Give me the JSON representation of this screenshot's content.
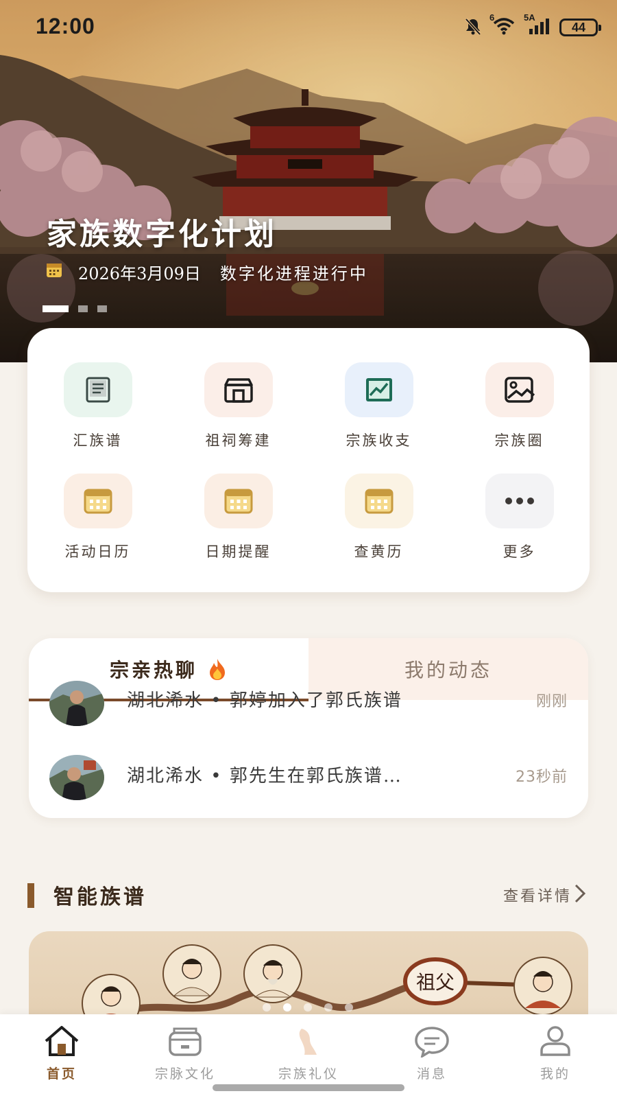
{
  "status_bar": {
    "time": "12:00",
    "network_label": "5A",
    "wifi_label": "6",
    "battery": "44",
    "icons": [
      "mute-bell-icon",
      "wifi-icon",
      "signal-icon",
      "battery-icon"
    ]
  },
  "hero": {
    "title": "家族数字化计划",
    "date": "2026年3月09日",
    "status": "数字化进程进行中",
    "carousel_pages": 3,
    "carousel_active": 1
  },
  "quick_grid": {
    "items": [
      {
        "label": "汇族谱",
        "icon": "book-icon",
        "bg": "#e9f5ee",
        "color": "#3a4a46"
      },
      {
        "label": "祖祠筹建",
        "icon": "temple-icon",
        "bg": "#fbeee8",
        "color": "#1e1e1e"
      },
      {
        "label": "宗族收支",
        "icon": "chart-icon",
        "bg": "#e8f0fb",
        "color": "#1e6c56"
      },
      {
        "label": "宗族圈",
        "icon": "image-icon",
        "bg": "#fbeee8",
        "color": "#1e1e1e"
      },
      {
        "label": "活动日历",
        "icon": "calendar-icon",
        "bg": "#fbeee4",
        "color": "#c79a3e"
      },
      {
        "label": "日期提醒",
        "icon": "calendar-icon",
        "bg": "#fbeee4",
        "color": "#c79a3e"
      },
      {
        "label": "查黄历",
        "icon": "calendar-icon",
        "bg": "#fbf3e4",
        "color": "#c79a3e"
      },
      {
        "label": "更多",
        "icon": "more-icon",
        "bg": "#f3f3f5",
        "color": "#3c3836"
      }
    ]
  },
  "chat": {
    "tabs": [
      {
        "label": "宗亲热聊",
        "icon": "fire-icon",
        "active": true
      },
      {
        "label": "我的动态",
        "active": false
      }
    ],
    "rows": [
      {
        "text": "湖北浠水 • 郭婷加入了郭氏族谱",
        "time": "刚刚"
      },
      {
        "text": "湖北浠水 • 郭先生在郭氏族谱…",
        "time": "23秒前"
      }
    ]
  },
  "section": {
    "title": "智能族谱",
    "link": "查看详情"
  },
  "tree_banner": {
    "node_label": "祖父",
    "carousel_pages": 5,
    "carousel_active": 2
  },
  "bottom_nav": {
    "items": [
      {
        "label": "首页",
        "icon": "home-icon",
        "active": true
      },
      {
        "label": "宗脉文化",
        "icon": "box-icon",
        "active": false
      },
      {
        "label": "宗族礼仪",
        "icon": "ritual-icon",
        "active": false
      },
      {
        "label": "消息",
        "icon": "message-icon",
        "active": false
      },
      {
        "label": "我的",
        "icon": "profile-icon",
        "active": false
      }
    ]
  },
  "colors": {
    "accent": "#8a5a2c",
    "page_bg": "#f6f2ec"
  }
}
